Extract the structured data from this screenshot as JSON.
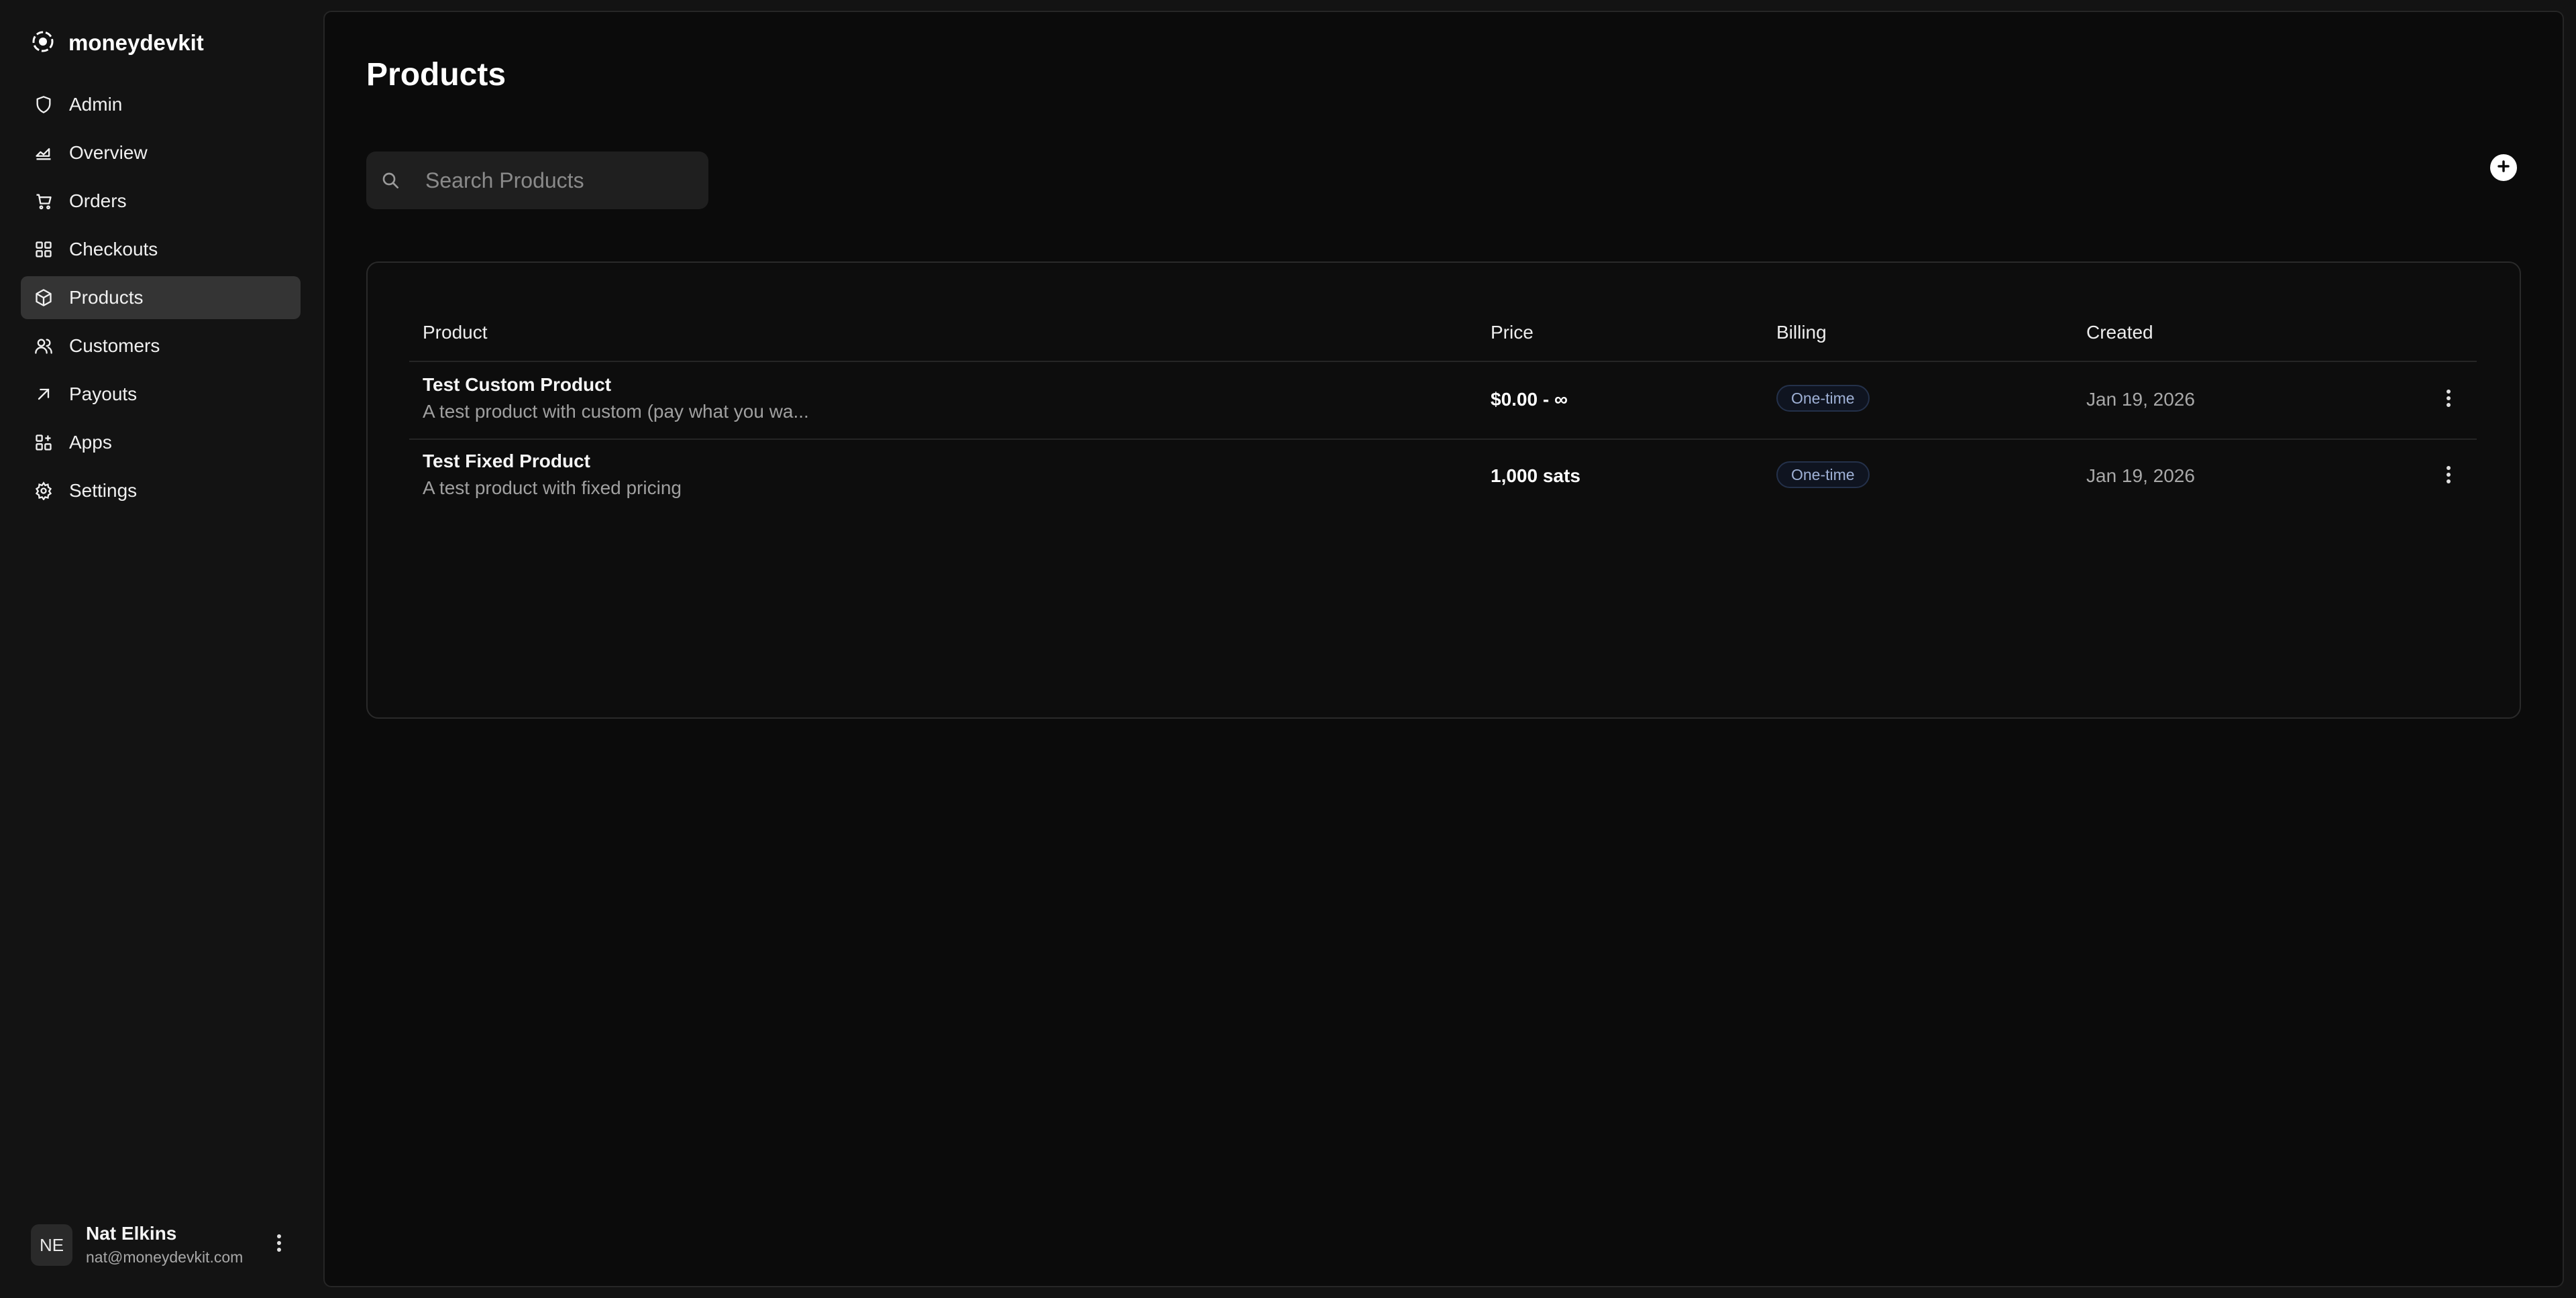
{
  "brand": {
    "name": "moneydevkit"
  },
  "sidebar": {
    "items": [
      {
        "label": "Admin",
        "icon": "shield-icon"
      },
      {
        "label": "Overview",
        "icon": "chart-area-icon"
      },
      {
        "label": "Orders",
        "icon": "cart-icon"
      },
      {
        "label": "Checkouts",
        "icon": "grid-icon"
      },
      {
        "label": "Products",
        "icon": "box-icon",
        "active": true
      },
      {
        "label": "Customers",
        "icon": "users-icon"
      },
      {
        "label": "Payouts",
        "icon": "arrow-up-right-icon"
      },
      {
        "label": "Apps",
        "icon": "apps-icon"
      },
      {
        "label": "Settings",
        "icon": "gear-icon"
      }
    ]
  },
  "user": {
    "initials": "NE",
    "name": "Nat Elkins",
    "email": "nat@moneydevkit.com"
  },
  "page": {
    "title": "Products"
  },
  "search": {
    "placeholder": "Search Products"
  },
  "table": {
    "columns": [
      "Product",
      "Price",
      "Billing",
      "Created"
    ],
    "rows": [
      {
        "name": "Test Custom Product",
        "description": "A test product with custom (pay what you wa...",
        "price": "$0.00 - ∞",
        "billing": "One-time",
        "created": "Jan 19, 2026"
      },
      {
        "name": "Test Fixed Product",
        "description": "A test product with fixed pricing",
        "price": "1,000 sats",
        "billing": "One-time",
        "created": "Jan 19, 2026"
      }
    ]
  },
  "colors": {
    "background": "#131313",
    "main": "#0b0b0b",
    "active_nav": "#343434",
    "badge_text": "#9fb1d6"
  }
}
